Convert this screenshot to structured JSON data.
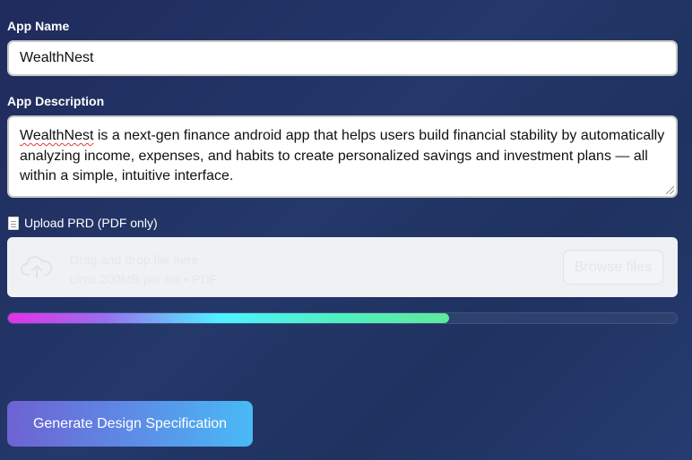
{
  "form": {
    "app_name_label": "App Name",
    "app_name_value": "WealthNest",
    "app_description_label": "App Description",
    "app_description_misspelled": "WealthNest",
    "app_description_rest": " is a next-gen finance android app that helps users build financial stability by automatically analyzing income, expenses, and habits to create personalized savings and investment plans — all within a simple, intuitive interface.",
    "upload_label": "Upload PRD (PDF only)",
    "dropzone_line1": "Drag and drop file here",
    "dropzone_line2": "Limit 200MB per file • PDF",
    "browse_label": "Browse files",
    "upload_icon": "cloud-upload-icon",
    "doc_icon": "page-icon"
  },
  "progress": {
    "fraction": 0.66,
    "colors": [
      "#e630e6",
      "#4ef2ff",
      "#5fe89a"
    ]
  },
  "actions": {
    "generate_label": "Generate Design Specification"
  },
  "colors": {
    "background": "#1f2b5c",
    "button_start": "#6e62d3",
    "button_end": "#49baf5"
  }
}
